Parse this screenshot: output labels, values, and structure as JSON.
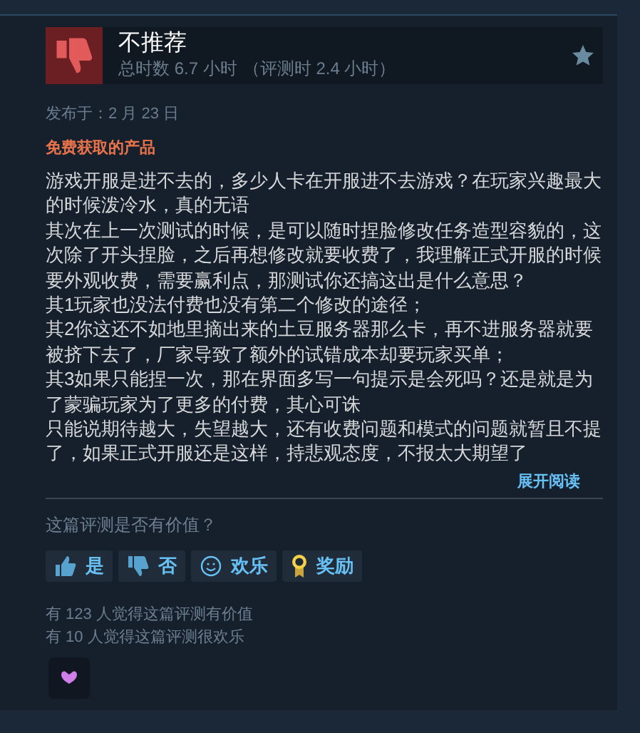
{
  "review": {
    "verdict": "不推荐",
    "recommended": false,
    "hours": "总时数 6.7 小时",
    "hours_at_review": "（评测时 2.4 小时）",
    "posted": "发布于：2 月 23 日",
    "tag": "免费获取的产品",
    "paragraphs": [
      "游戏开服是进不去的，多少人卡在开服进不去游戏？在玩家兴趣最大的时候泼冷水，真的无语",
      "其次在上一次测试的时候，是可以随时捏脸修改任务造型容貌的，这次除了开头捏脸，之后再想修改就要收费了，我理解正式开服的时候要外观收费，需要赢利点，那测试你还搞这出是什么意思？",
      "其1玩家也没法付费也没有第二个修改的途径；",
      "其2你这还不如地里摘出来的土豆服务器那么卡，再不进服务器就要被挤下去了，厂家导致了额外的试错成本却要玩家买单；",
      "其3如果只能捏一次，那在界面多写一句提示是会死吗？还是就是为了蒙骗玩家为了更多的付费，其心可诛",
      "只能说期待越大，失望越大，还有收费问题和模式的问题就暂且不提了，如果正式开服还是这样，持悲观态度，不报太大期望了"
    ],
    "expand": "展开阅读"
  },
  "feedback": {
    "question": "这篇评测是否有价值？",
    "buttons": [
      {
        "kind": "yes",
        "label": "是"
      },
      {
        "kind": "no",
        "label": "否"
      },
      {
        "kind": "funny",
        "label": "欢乐"
      },
      {
        "kind": "award",
        "label": "奖励"
      }
    ],
    "counts": [
      "有 123 人觉得这篇评测有价值",
      "有 10 人觉得这篇评测很欢乐"
    ],
    "awards": [
      {
        "kind": "heart"
      }
    ]
  }
}
